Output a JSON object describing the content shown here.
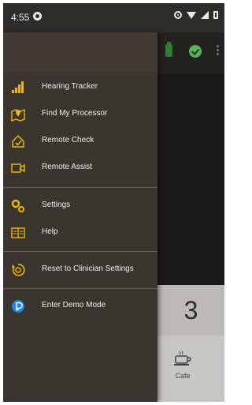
{
  "status_bar": {
    "time": "4:55",
    "icons": [
      "app-notification-icon",
      "eye-icon",
      "wifi-icon",
      "signal-icon",
      "battery-icon"
    ]
  },
  "drawer": {
    "items": [
      {
        "label": "Hearing Tracker",
        "icon": "bar-chart-icon"
      },
      {
        "label": "Find My Processor",
        "icon": "map-pin-icon"
      },
      {
        "label": "Remote Check",
        "icon": "home-check-icon"
      },
      {
        "label": "Remote Assist",
        "icon": "video-camera-icon"
      },
      {
        "label": "Settings",
        "icon": "gears-icon"
      },
      {
        "label": "Help",
        "icon": "book-icon"
      },
      {
        "label": "Reset to Clinician Settings",
        "icon": "reset-icon"
      },
      {
        "label": "Enter Demo Mode",
        "icon": "demo-mode-icon"
      }
    ]
  },
  "background_app": {
    "program_number": "3",
    "program_label": "Cafe"
  },
  "colors": {
    "accent": "#f2b705",
    "drawer_bg": "#3a352f",
    "status_ok": "#58b658"
  }
}
